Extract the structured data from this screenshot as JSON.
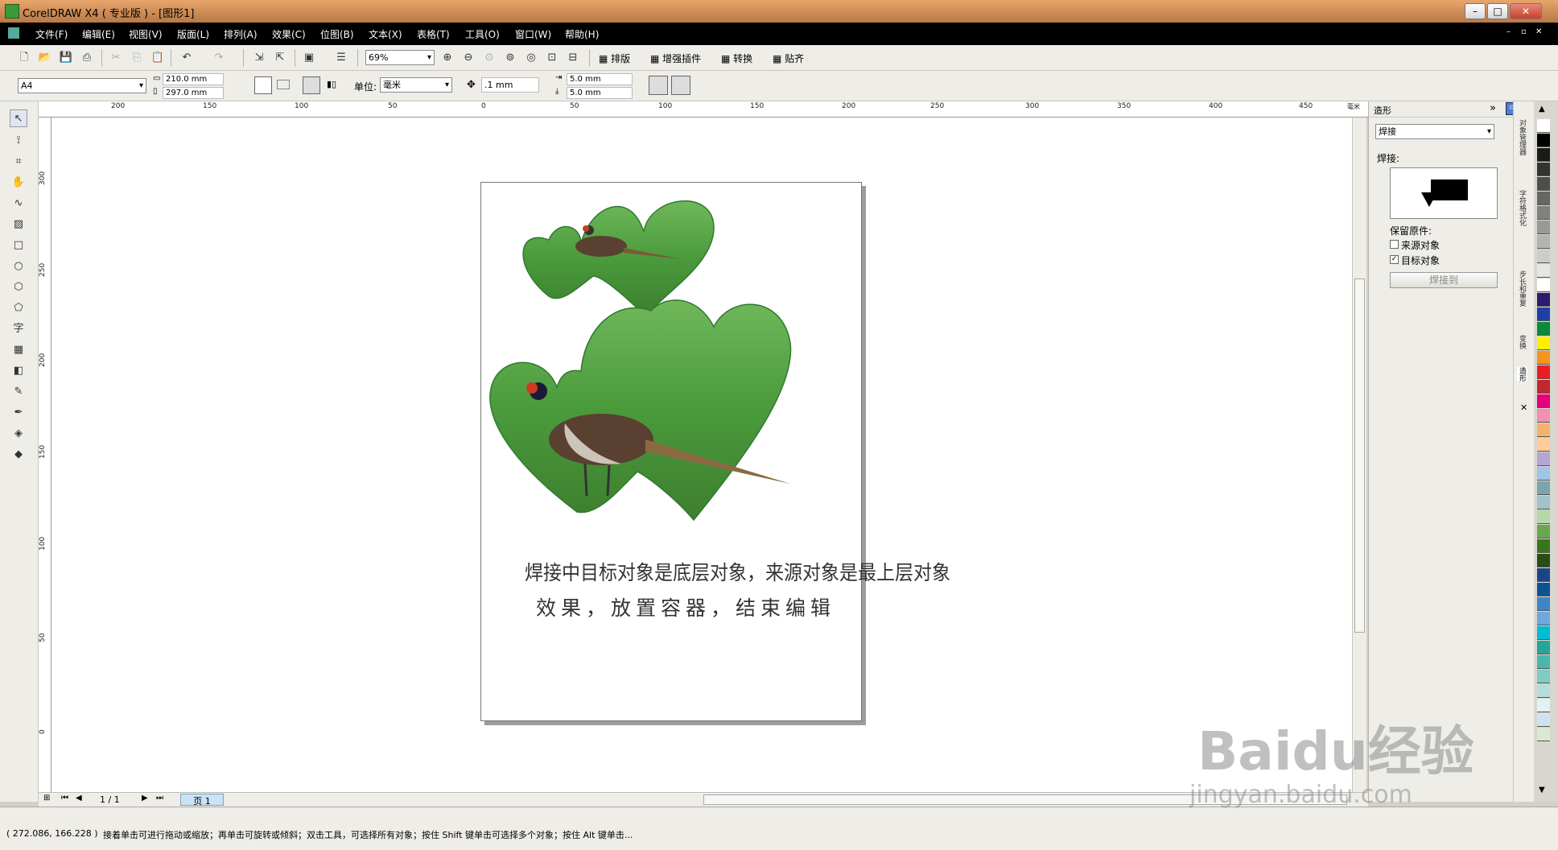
{
  "window": {
    "title": "CorelDRAW X4 ( 专业版 ) - [图形1]"
  },
  "menu": [
    "文件(F)",
    "编辑(E)",
    "视图(V)",
    "版面(L)",
    "排列(A)",
    "效果(C)",
    "位图(B)",
    "文本(X)",
    "表格(T)",
    "工具(O)",
    "窗口(W)",
    "帮助(H)"
  ],
  "toolbar": {
    "zoom": "69%",
    "plugins": [
      "排版",
      "增强插件",
      "转换",
      "贴齐"
    ]
  },
  "propbar": {
    "paper_size": "A4",
    "width": "210.0 mm",
    "height": "297.0 mm",
    "unit_label": "单位:",
    "unit": "毫米",
    "nudge": ".1 mm",
    "dup_x": "5.0 mm",
    "dup_y": "5.0 mm"
  },
  "ruler": {
    "top_ticks": [
      "200",
      "150",
      "100",
      "50",
      "0",
      "50",
      "100",
      "150",
      "200",
      "250",
      "300",
      "350",
      "400",
      "450"
    ],
    "left_ticks": [
      "300",
      "250",
      "200",
      "150",
      "100",
      "50",
      "0"
    ],
    "top_unit": "毫米"
  },
  "canvas": {
    "caption_line1": "焊接中目标对象是底层对象，来源对象是最上层对象",
    "caption_line2": "效果，放置容器，结束编辑"
  },
  "docker": {
    "title": "造形",
    "mode": "焊接",
    "section": "焊接:",
    "keep_label": "保留原件:",
    "source_label": "来源对象",
    "source_checked": false,
    "target_label": "目标对象",
    "target_checked": true,
    "apply_button": "焊接到"
  },
  "docker_tabs": [
    "对象管理器",
    "字符格式化",
    "步长和重复",
    "变换",
    "造形"
  ],
  "navigator": {
    "page_count": "1 / 1",
    "page_tab": "页 1"
  },
  "status": {
    "coords": "( 272.086, 166.228 )",
    "hint": "接着单击可进行拖动或缩放；再单击可旋转或倾斜；双击工具，可选择所有对象；按住 Shift 键单击可选择多个对象；按住 Alt 键单击..."
  },
  "watermark": {
    "brand": "Baidu经验",
    "url": "jingyan.baidu.com"
  },
  "palette_colors": [
    "#ffffff",
    "#000000",
    "#1a1a1a",
    "#333333",
    "#4d4d4d",
    "#666666",
    "#808080",
    "#999999",
    "#b3b3b3",
    "#cccccc",
    "#e6e6e6",
    "#ffffff",
    "#2b1a6e",
    "#1f3fa8",
    "#0a8a3a",
    "#ffee00",
    "#f7941d",
    "#ed1c24",
    "#c1272d",
    "#e4007f",
    "#f48fb1",
    "#f6b26b",
    "#ffcc99",
    "#b4a7d6",
    "#9fc5e8",
    "#76a5af",
    "#a2c4c9",
    "#b6d7a8",
    "#6aa84f",
    "#38761d",
    "#274e13",
    "#1c4587",
    "#0b5394",
    "#3d85c6",
    "#6fa8dc",
    "#00bcd4",
    "#26a69a",
    "#4db6ac",
    "#80cbc4",
    "#b2dfdb",
    "#e0f2f1",
    "#cfe2f3",
    "#d9ead3"
  ]
}
